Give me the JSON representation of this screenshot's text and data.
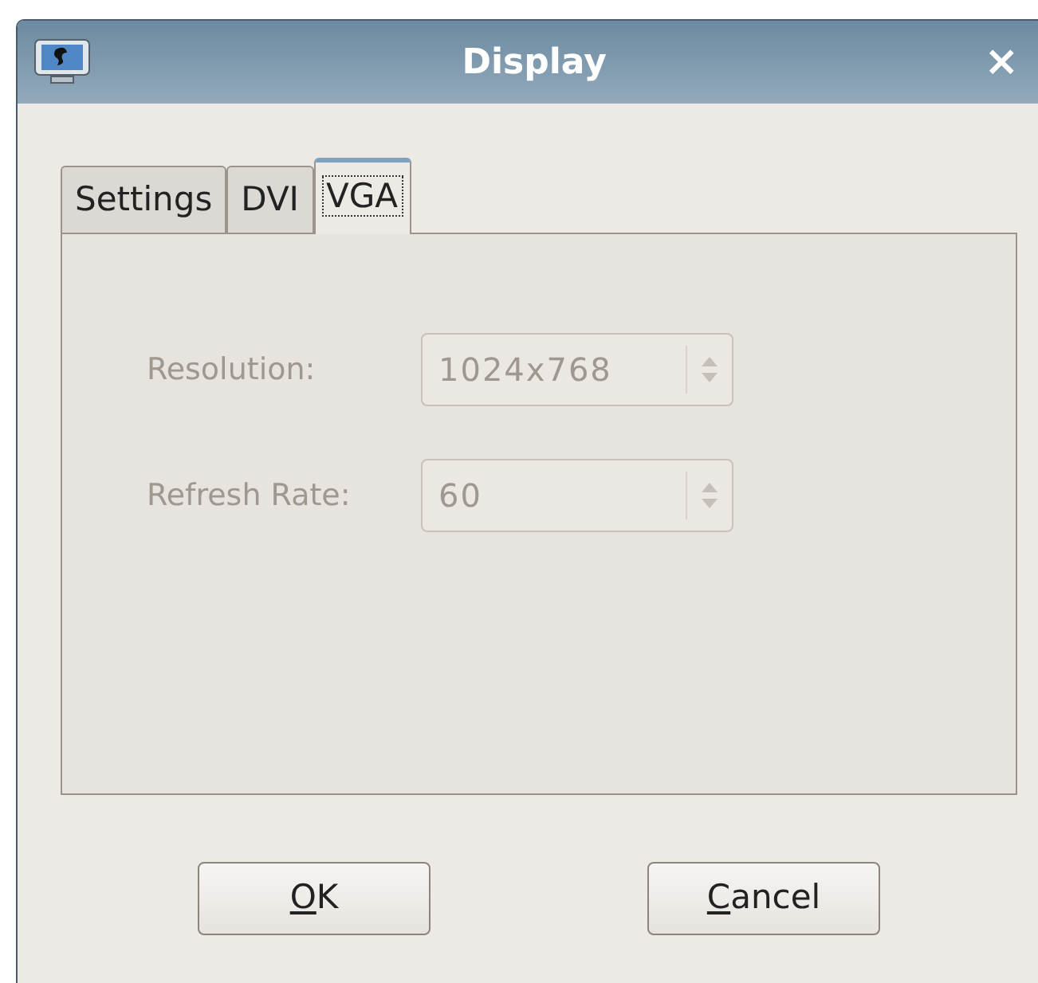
{
  "window": {
    "title": "Display",
    "close": "×"
  },
  "tabs": [
    {
      "label": "Settings",
      "selected": false
    },
    {
      "label": "DVI",
      "selected": false
    },
    {
      "label": "VGA",
      "selected": true
    }
  ],
  "fields": [
    {
      "label": "Resolution:",
      "value": "1024x768",
      "disabled": true
    },
    {
      "label": "Refresh Rate:",
      "value": "60",
      "disabled": true
    }
  ],
  "buttons": [
    {
      "label": "OK",
      "mnemonic": true
    },
    {
      "label": "Cancel",
      "mnemonic": true
    }
  ]
}
